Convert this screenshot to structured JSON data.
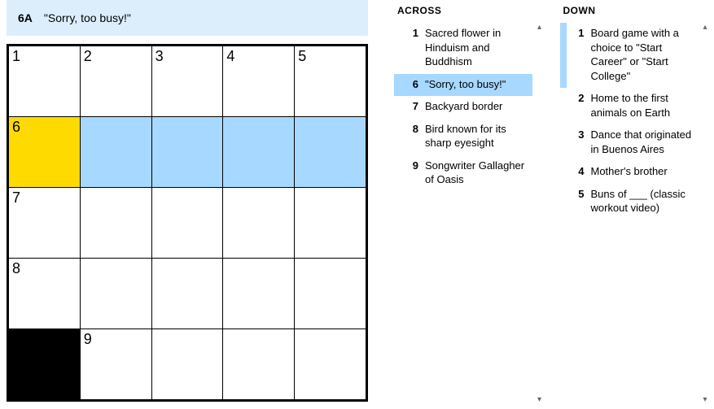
{
  "current_clue": {
    "label": "6A",
    "text": "\"Sorry, too busy!\""
  },
  "grid": {
    "rows": 5,
    "cols": 5,
    "cells": [
      {
        "r": 0,
        "c": 0,
        "num": "1"
      },
      {
        "r": 0,
        "c": 1,
        "num": "2"
      },
      {
        "r": 0,
        "c": 2,
        "num": "3"
      },
      {
        "r": 0,
        "c": 3,
        "num": "4"
      },
      {
        "r": 0,
        "c": 4,
        "num": "5"
      },
      {
        "r": 1,
        "c": 0,
        "num": "6",
        "cursor": true
      },
      {
        "r": 1,
        "c": 1,
        "hl": true
      },
      {
        "r": 1,
        "c": 2,
        "hl": true
      },
      {
        "r": 1,
        "c": 3,
        "hl": true
      },
      {
        "r": 1,
        "c": 4,
        "hl": true
      },
      {
        "r": 2,
        "c": 0,
        "num": "7"
      },
      {
        "r": 2,
        "c": 1
      },
      {
        "r": 2,
        "c": 2
      },
      {
        "r": 2,
        "c": 3
      },
      {
        "r": 2,
        "c": 4
      },
      {
        "r": 3,
        "c": 0,
        "num": "8"
      },
      {
        "r": 3,
        "c": 1
      },
      {
        "r": 3,
        "c": 2
      },
      {
        "r": 3,
        "c": 3
      },
      {
        "r": 3,
        "c": 4
      },
      {
        "r": 4,
        "c": 0,
        "black": true
      },
      {
        "r": 4,
        "c": 1,
        "num": "9"
      },
      {
        "r": 4,
        "c": 2
      },
      {
        "r": 4,
        "c": 3
      },
      {
        "r": 4,
        "c": 4
      }
    ]
  },
  "across": {
    "header": "ACROSS",
    "clues": [
      {
        "num": "1",
        "text": "Sacred flower in Hinduism and Buddhism"
      },
      {
        "num": "6",
        "text": "\"Sorry, too busy!\"",
        "active": true
      },
      {
        "num": "7",
        "text": "Backyard border"
      },
      {
        "num": "8",
        "text": "Bird known for its sharp eyesight"
      },
      {
        "num": "9",
        "text": "Songwriter Gallagher of Oasis"
      }
    ]
  },
  "down": {
    "header": "DOWN",
    "clues": [
      {
        "num": "1",
        "text": "Board game with a choice to \"Start Career\" or \"Start College\"",
        "related": true
      },
      {
        "num": "2",
        "text": "Home to the first animals on Earth"
      },
      {
        "num": "3",
        "text": "Dance that originated in Buenos Aires"
      },
      {
        "num": "4",
        "text": "Mother's brother"
      },
      {
        "num": "5",
        "text": "Buns of ___ (classic workout video)"
      }
    ]
  },
  "scroll": {
    "up": "▴",
    "down": "▾"
  }
}
